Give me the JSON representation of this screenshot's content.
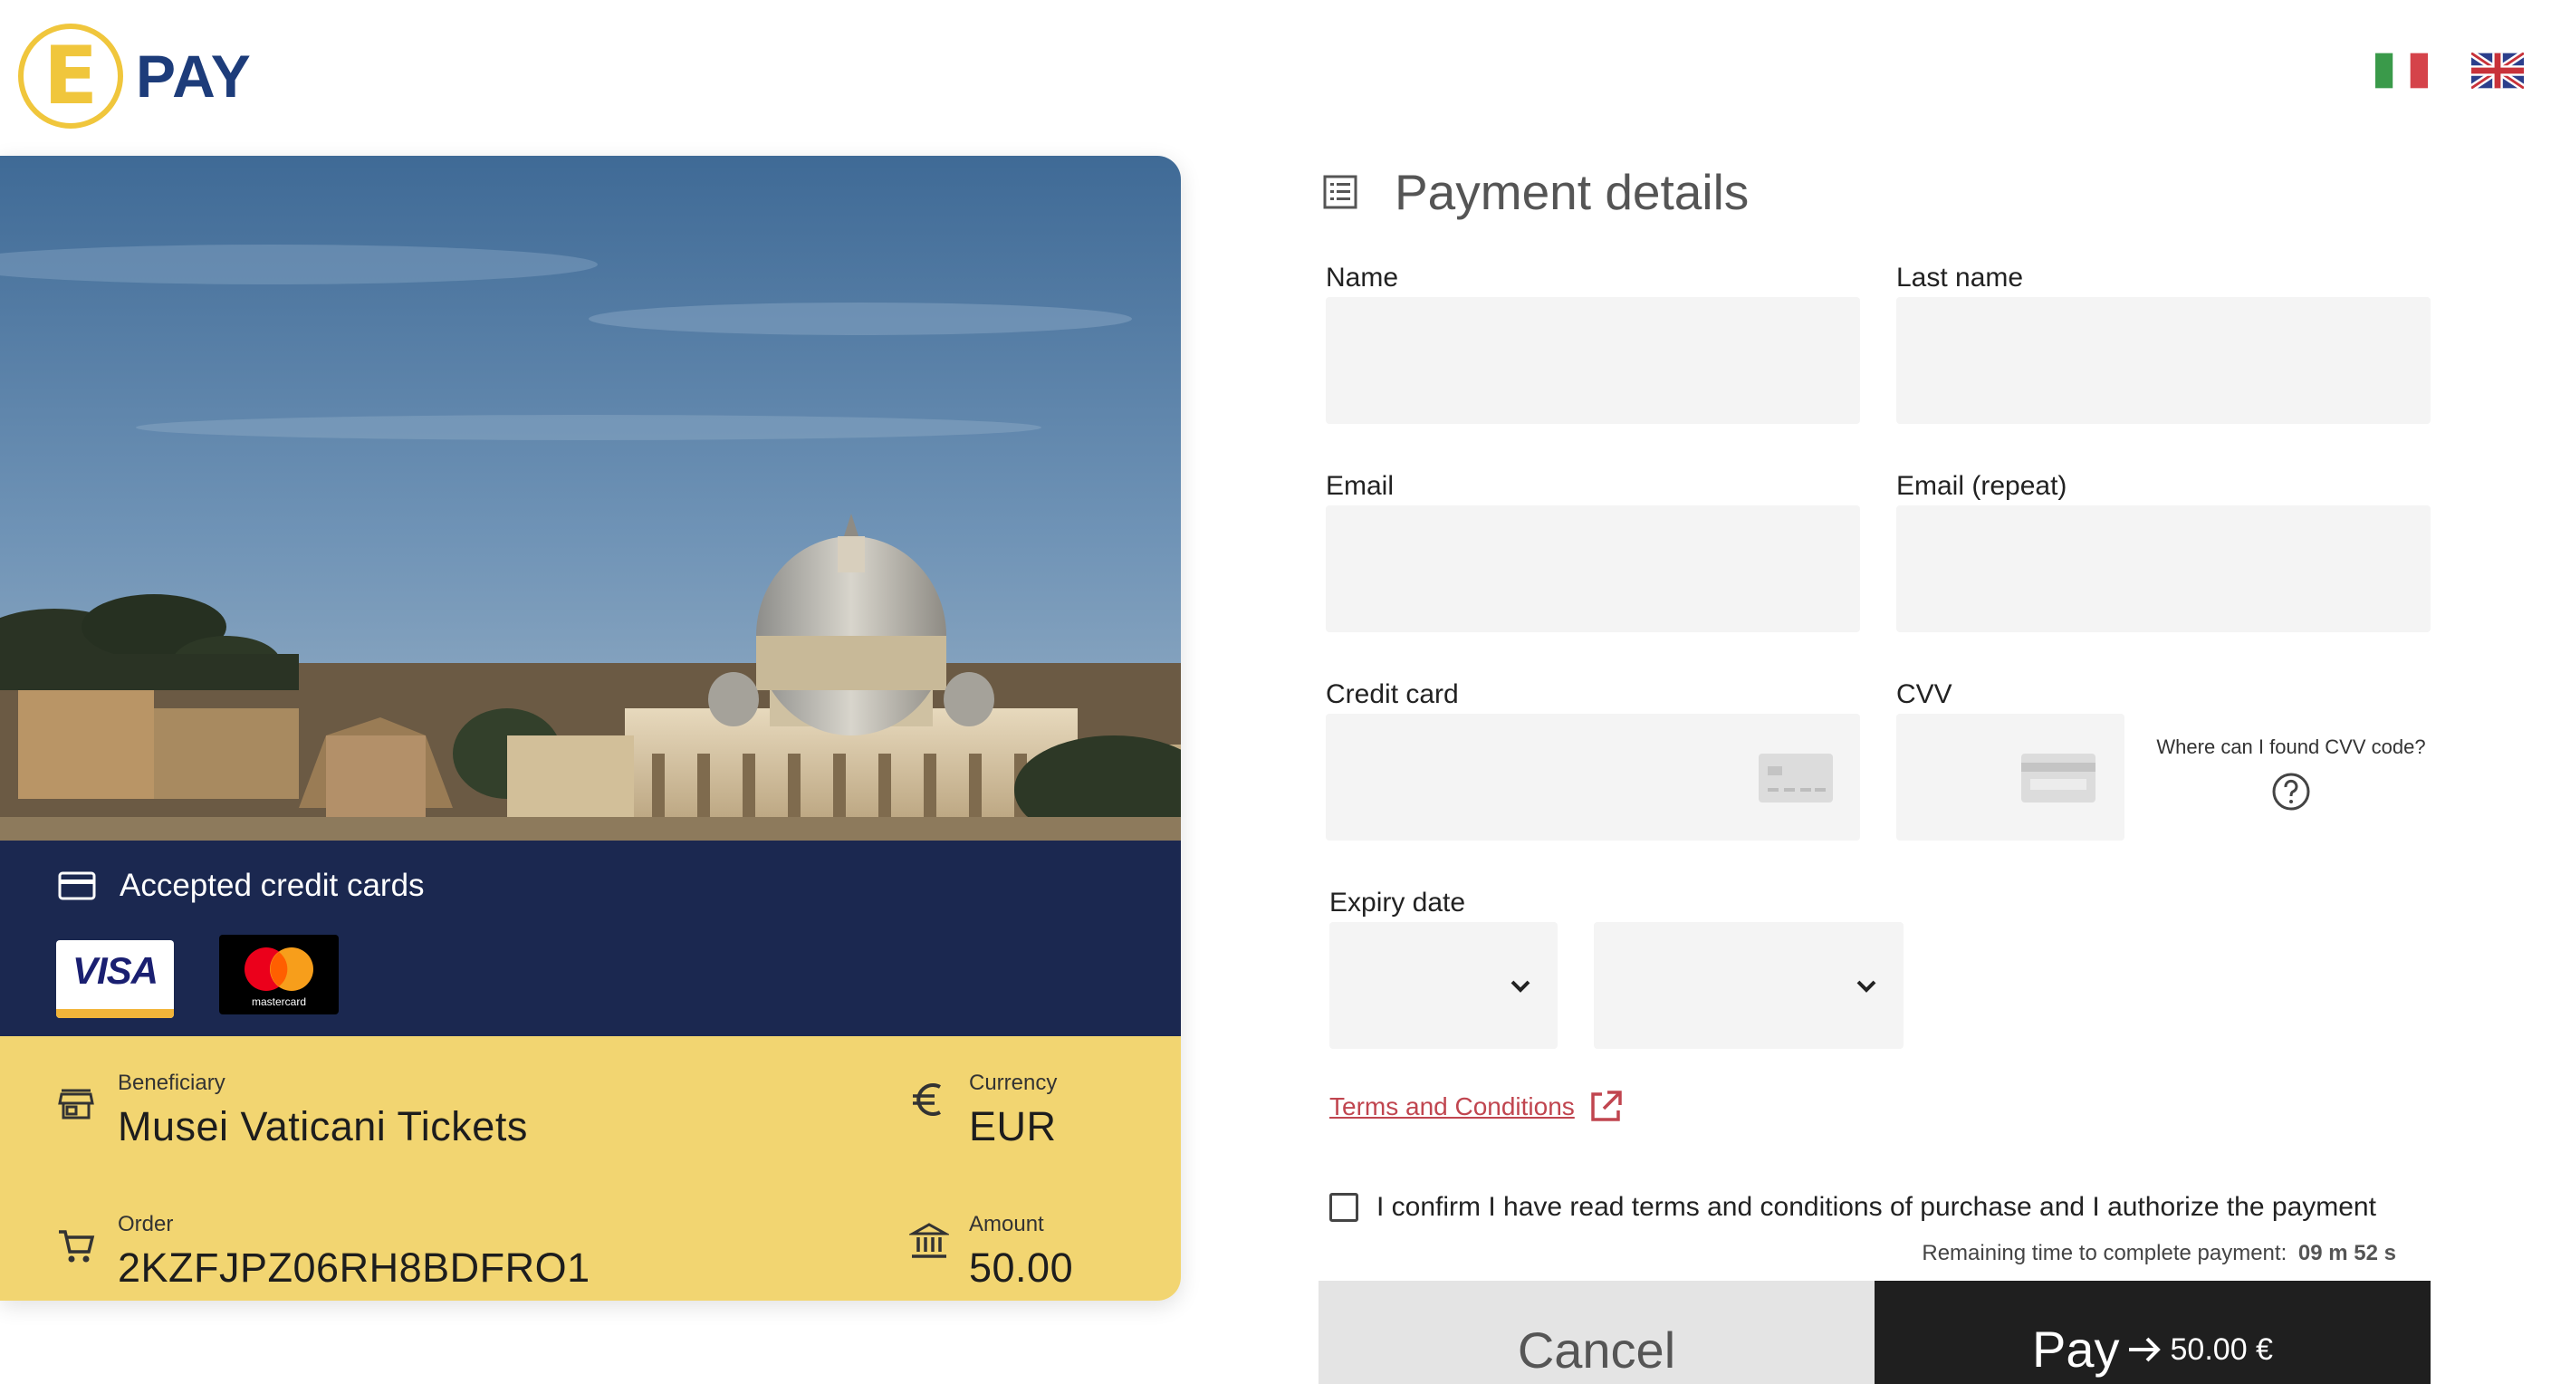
{
  "header": {
    "logo_letter": "E",
    "logo_text": "PAY",
    "flags": [
      "italian-flag",
      "uk-flag"
    ]
  },
  "card": {
    "accepted_title": "Accepted credit cards",
    "visa_text": "VISA",
    "mastercard_text": "mastercard",
    "beneficiary_label": "Beneficiary",
    "beneficiary_value": "Musei Vaticani Tickets",
    "currency_label": "Currency",
    "currency_value": "EUR",
    "order_label": "Order",
    "order_value": "2KZFJPZ06RH8BDFRO1",
    "amount_label": "Amount",
    "amount_value": "50.00"
  },
  "form": {
    "title": "Payment details",
    "name_label": "Name",
    "name_value": "",
    "lastname_label": "Last name",
    "lastname_value": "",
    "email_label": "Email",
    "email_value": "",
    "email_repeat_label": "Email (repeat)",
    "email_repeat_value": "",
    "credit_card_label": "Credit card",
    "credit_card_value": "",
    "cvv_label": "CVV",
    "cvv_value": "",
    "cvv_help_text": "Where can I found CVV code?",
    "expiry_label": "Expiry date",
    "expiry_month": "",
    "expiry_year": "",
    "terms_link": "Terms and Conditions",
    "confirm_text": "I confirm I have read terms and conditions of purchase and I authorize the payment",
    "confirm_checked": false,
    "remaining_label": "Remaining time to complete payment:",
    "remaining_value": "09 m 52 s",
    "cancel_label": "Cancel",
    "pay_label": "Pay",
    "pay_amount": "50.00 €"
  },
  "colors": {
    "logo_yellow": "#f0c63c",
    "logo_blue": "#1d3c7a",
    "card_navy": "#1b2850",
    "info_yellow": "#f2d571",
    "terms_red": "#c0454f",
    "pay_black": "#1f1f1f",
    "cancel_gray": "#e4e4e4"
  }
}
